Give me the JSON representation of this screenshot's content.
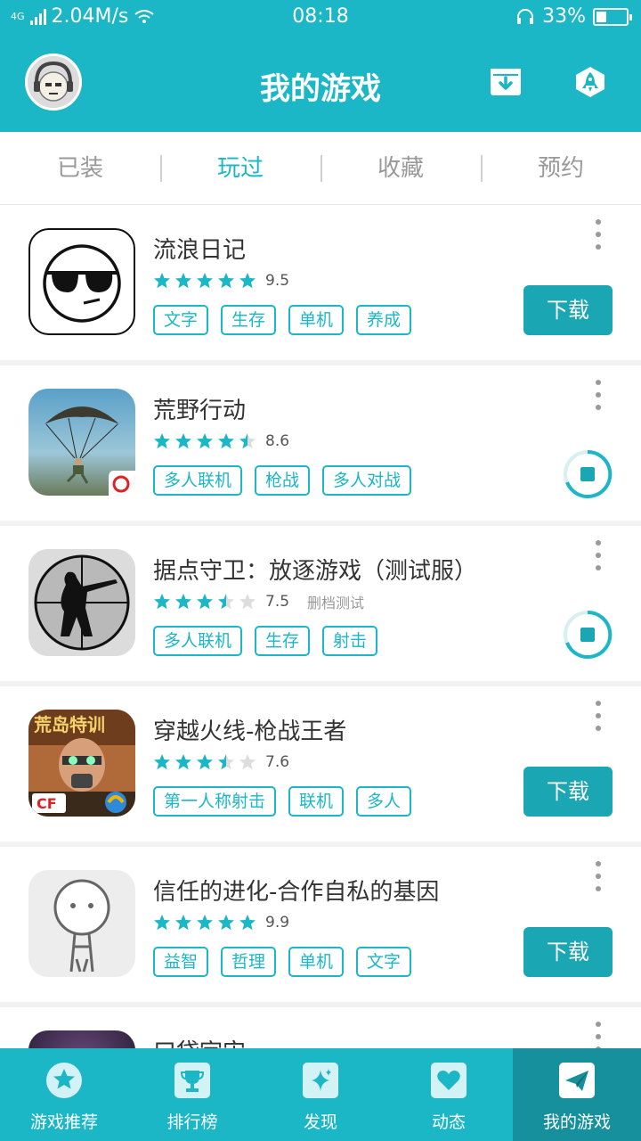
{
  "status_bar": {
    "network": "4G",
    "speed": "2.04M/s",
    "time": "08:18",
    "battery": "33%",
    "battery_level": 0.33
  },
  "header": {
    "title": "我的游戏",
    "download_manager_icon": "download-box-icon",
    "rocket_icon": "rocket-icon"
  },
  "tabs": [
    {
      "label": "已装",
      "active": false
    },
    {
      "label": "玩过",
      "active": true
    },
    {
      "label": "收藏",
      "active": false
    },
    {
      "label": "预约",
      "active": false
    }
  ],
  "games": [
    {
      "name": "流浪日记",
      "stars": 5,
      "score": "9.5",
      "note": "",
      "tags": [
        "文字",
        "生存",
        "单机",
        "养成"
      ],
      "action": "下载",
      "action_type": "download"
    },
    {
      "name": "荒野行动",
      "stars": 4.5,
      "score": "8.6",
      "note": "",
      "tags": [
        "多人联机",
        "枪战",
        "多人对战"
      ],
      "action": "",
      "action_type": "pause"
    },
    {
      "name": "据点守卫：放逐游戏（测试服）",
      "stars": 3.5,
      "score": "7.5",
      "note": "删档测试",
      "tags": [
        "多人联机",
        "生存",
        "射击"
      ],
      "action": "",
      "action_type": "pause"
    },
    {
      "name": "穿越火线-枪战王者",
      "stars": 3.5,
      "score": "7.6",
      "note": "",
      "tags": [
        "第一人称射击",
        "联机",
        "多人"
      ],
      "action": "下载",
      "action_type": "download"
    },
    {
      "name": "信任的进化-合作自私的基因",
      "stars": 5,
      "score": "9.9",
      "note": "",
      "tags": [
        "益智",
        "哲理",
        "单机",
        "文字"
      ],
      "action": "下载",
      "action_type": "download"
    },
    {
      "name": "口袋宇宙",
      "stars": 0,
      "score": "",
      "note": "",
      "tags": [],
      "action": "",
      "action_type": "none"
    }
  ],
  "bottom_nav": [
    {
      "label": "游戏推荐",
      "icon": "star-icon",
      "active": false
    },
    {
      "label": "排行榜",
      "icon": "trophy-icon",
      "active": false
    },
    {
      "label": "发现",
      "icon": "sparkle-icon",
      "active": false
    },
    {
      "label": "动态",
      "icon": "heart-icon",
      "active": false
    },
    {
      "label": "我的游戏",
      "icon": "paper-plane-icon",
      "active": true
    }
  ],
  "colors": {
    "accent": "#1bb7c6",
    "accent_dark": "#1aa6b3",
    "nav_active": "#16909c"
  }
}
